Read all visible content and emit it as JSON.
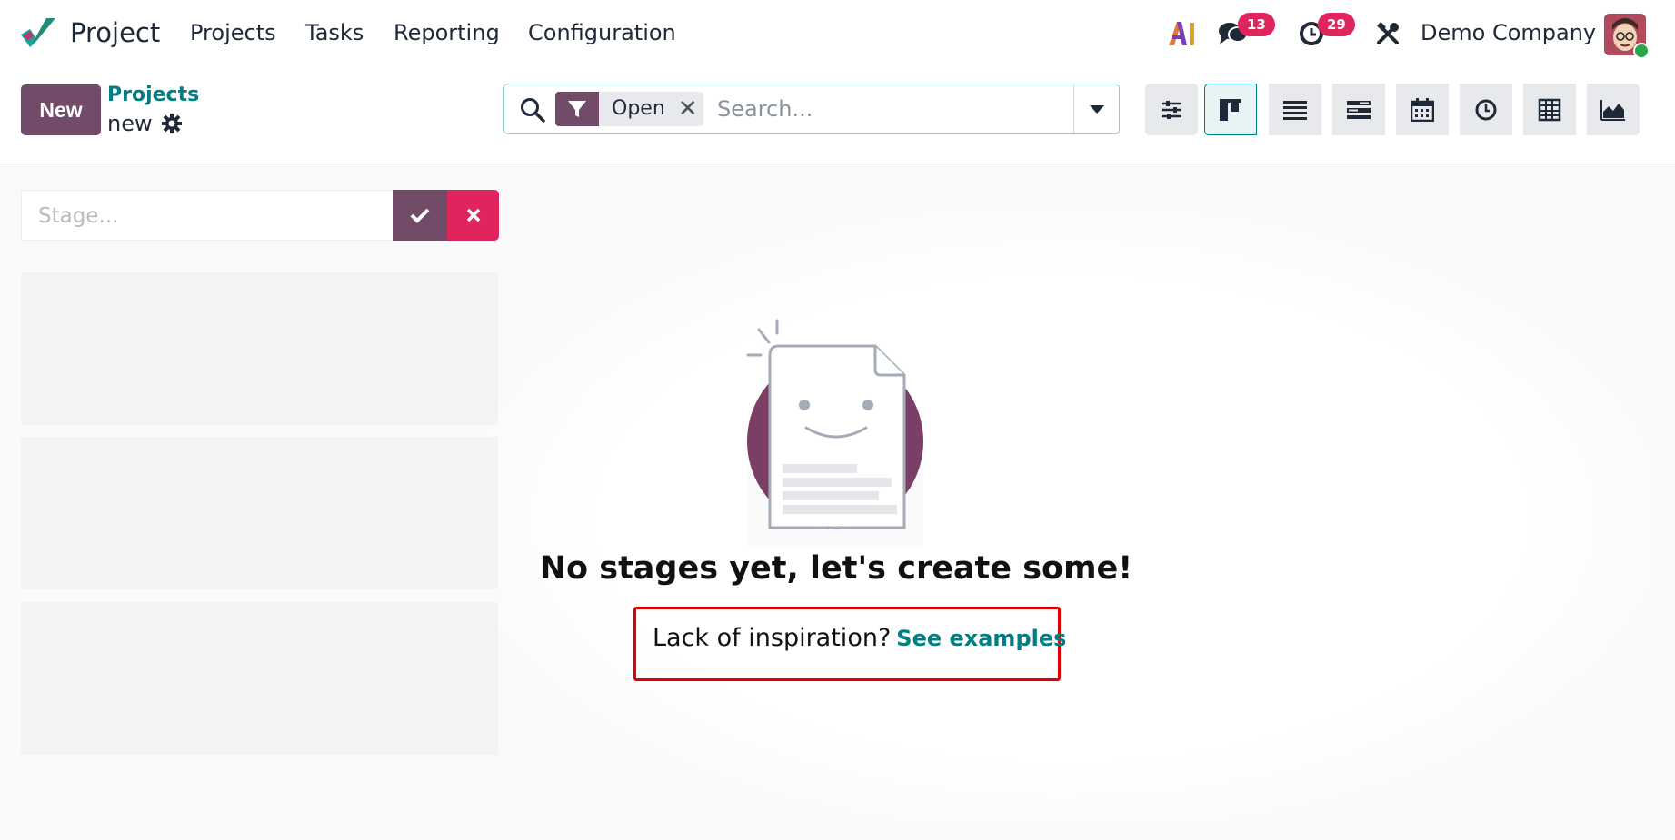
{
  "navbar": {
    "app_name": "Project",
    "menus": [
      "Projects",
      "Tasks",
      "Reporting",
      "Configuration"
    ],
    "discuss_count": "13",
    "activity_count": "29",
    "company": "Demo Company"
  },
  "control": {
    "new_label": "New",
    "breadcrumb_parent": "Projects",
    "breadcrumb_current": "new",
    "facet_label": "Open",
    "facet_close": "✕",
    "search_placeholder": "Search..."
  },
  "kanban": {
    "stage_placeholder": "Stage...",
    "empty_title": "No stages yet, let's create some!",
    "hint_text": "Lack of inspiration?",
    "hint_link": "See examples"
  },
  "colors": {
    "brand": "#714b67",
    "teal": "#017e84",
    "danger": "#e0245e",
    "highlight": "#e00000"
  }
}
